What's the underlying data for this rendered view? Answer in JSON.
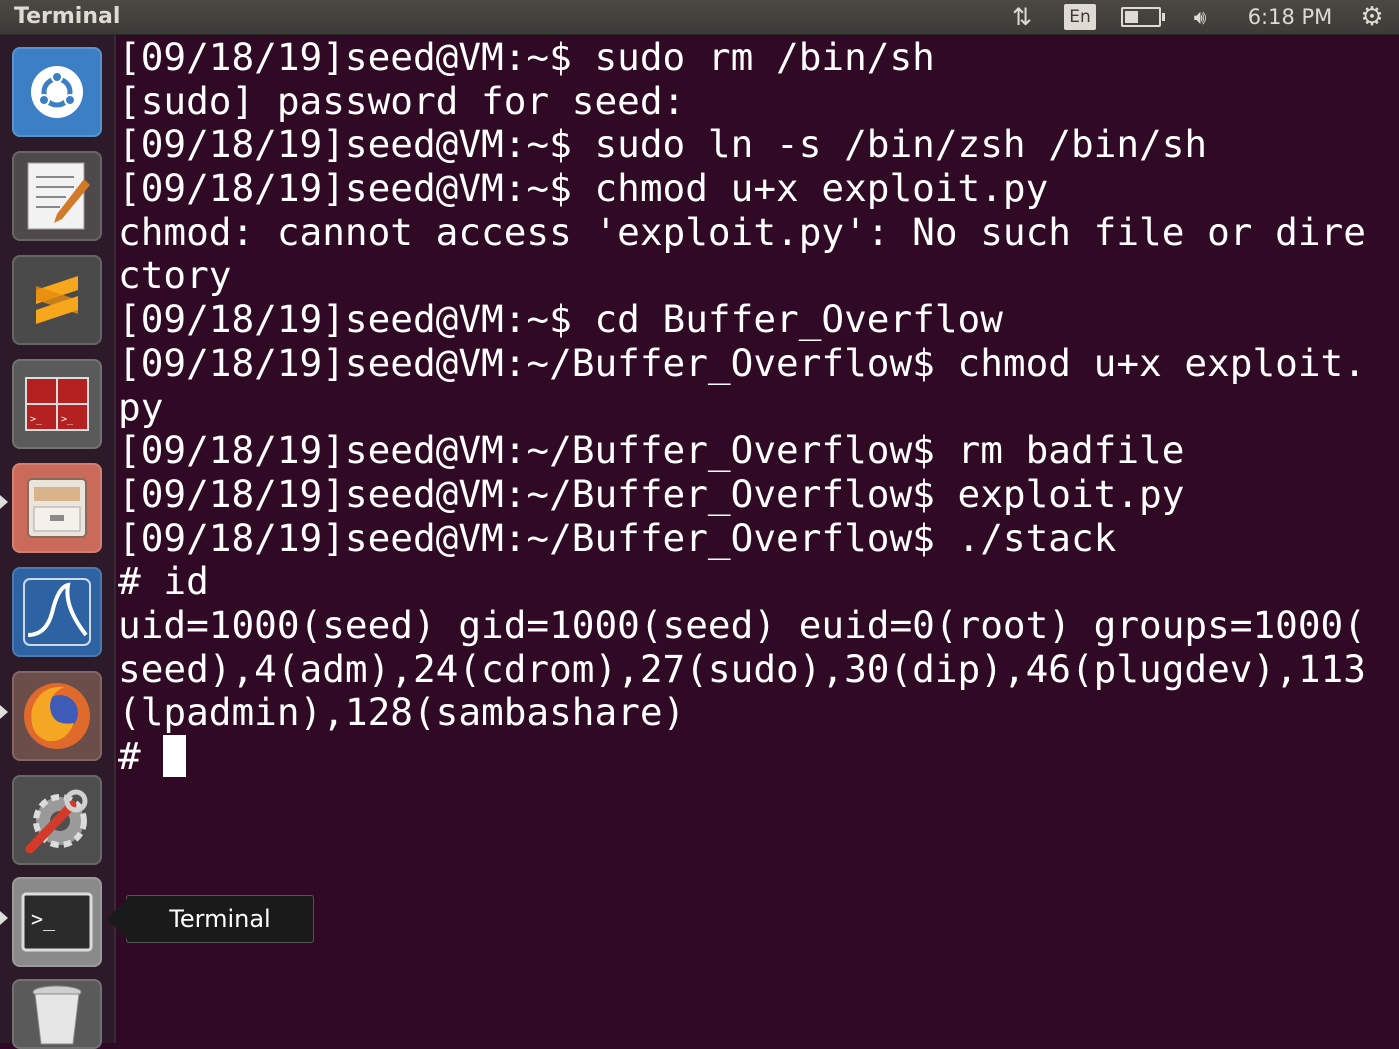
{
  "top_panel": {
    "title": "Terminal",
    "network_icon": "up-down-arrows-icon",
    "language": "En",
    "battery_level": 0.4,
    "volume_icon": "speaker-icon",
    "clock": "6:18 PM",
    "settings_icon": "gear-icon"
  },
  "launcher": {
    "items": [
      {
        "name": "ubuntu-dash",
        "icon": "ubuntu-logo-icon",
        "color": "#3d7fc5"
      },
      {
        "name": "text-editor",
        "icon": "text-editor-icon",
        "color": "#cfcfcf"
      },
      {
        "name": "sublime-text",
        "icon": "sublime-text-icon",
        "color": "#4a4a4a"
      },
      {
        "name": "terminator",
        "icon": "terminator-icon",
        "color": "#b52020"
      },
      {
        "name": "files",
        "icon": "file-cabinet-icon",
        "color": "#c96a5a"
      },
      {
        "name": "wireshark",
        "icon": "wireshark-fin-icon",
        "color": "#2d62a3"
      },
      {
        "name": "firefox",
        "icon": "firefox-icon",
        "color": "#e06a2b"
      },
      {
        "name": "system-settings",
        "icon": "wrench-gear-icon",
        "color": "#6c6c6c"
      },
      {
        "name": "terminal",
        "icon": "terminal-prompt-icon",
        "color": "#7a7a7a"
      },
      {
        "name": "trash",
        "icon": "trash-icon",
        "color": "#9a9a9a"
      }
    ],
    "tooltip": "Terminal"
  },
  "terminal": {
    "lines": [
      "[09/18/19]seed@VM:~$ sudo rm /bin/sh",
      "[sudo] password for seed:",
      "[09/18/19]seed@VM:~$ sudo ln -s /bin/zsh /bin/sh",
      "[09/18/19]seed@VM:~$ chmod u+x exploit.py",
      "chmod: cannot access 'exploit.py': No such file or dire",
      "ctory",
      "[09/18/19]seed@VM:~$ cd Buffer_Overflow",
      "[09/18/19]seed@VM:~/Buffer_Overflow$ chmod u+x exploit.",
      "py",
      "[09/18/19]seed@VM:~/Buffer_Overflow$ rm badfile",
      "[09/18/19]seed@VM:~/Buffer_Overflow$ exploit.py",
      "[09/18/19]seed@VM:~/Buffer_Overflow$ ./stack",
      "# id",
      "uid=1000(seed) gid=1000(seed) euid=0(root) groups=1000(",
      "seed),4(adm),24(cdrom),27(sudo),30(dip),46(plugdev),113",
      "(lpadmin),128(sambashare)"
    ],
    "prompt": "# ",
    "colors": {
      "background": "#300a24",
      "foreground": "#ffffff"
    }
  }
}
